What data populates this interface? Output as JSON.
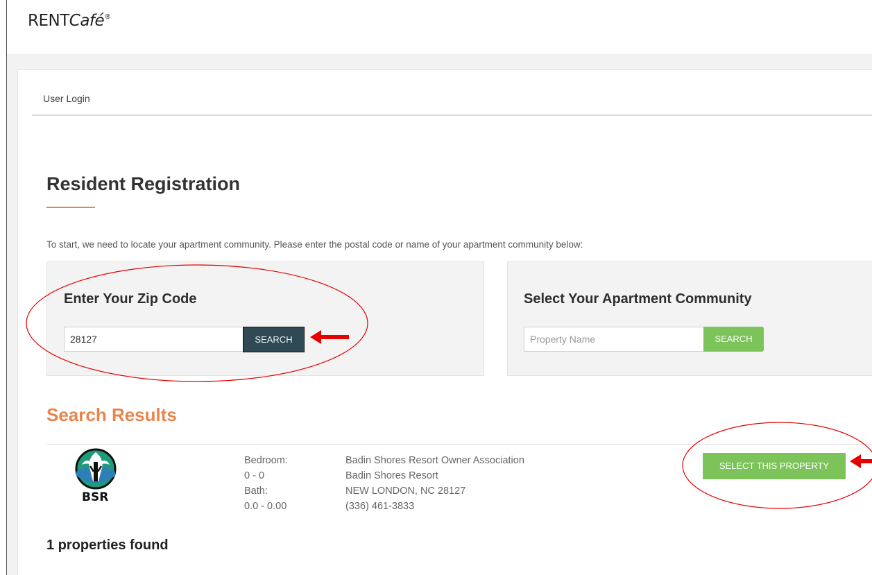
{
  "header": {
    "logo_rent": "RENT",
    "logo_cafe": "Café",
    "logo_reg": "®"
  },
  "nav": {
    "user_login": "User Login"
  },
  "page": {
    "title": "Resident Registration",
    "intro": "To start, we need to locate your apartment community. Please enter the postal code or name of your apartment community below:"
  },
  "zip_panel": {
    "heading": "Enter Your Zip Code",
    "input_value": "28127",
    "button_label": "SEARCH"
  },
  "community_panel": {
    "heading": "Select Your Apartment Community",
    "input_placeholder": "Property Name",
    "button_label": "SEARCH"
  },
  "results": {
    "title": "Search Results",
    "items": [
      {
        "logo_text": "BSR",
        "bedroom_label": "Bedroom:",
        "bedroom_value": "0 - 0",
        "bath_label": "Bath:",
        "bath_value": "0.0 - 0.00",
        "association": "Badin Shores Resort Owner Association",
        "name": "Badin Shores Resort",
        "city_state_zip": "NEW LONDON, NC 28127",
        "phone": "(336) 461-3833",
        "select_label": "SELECT THIS PROPERTY"
      }
    ],
    "count_text": "1 properties found"
  },
  "colors": {
    "accent_orange": "#e8854d",
    "green_button": "#7cc35a",
    "dark_button": "#2f4a55",
    "annotation_red": "#e60000"
  }
}
